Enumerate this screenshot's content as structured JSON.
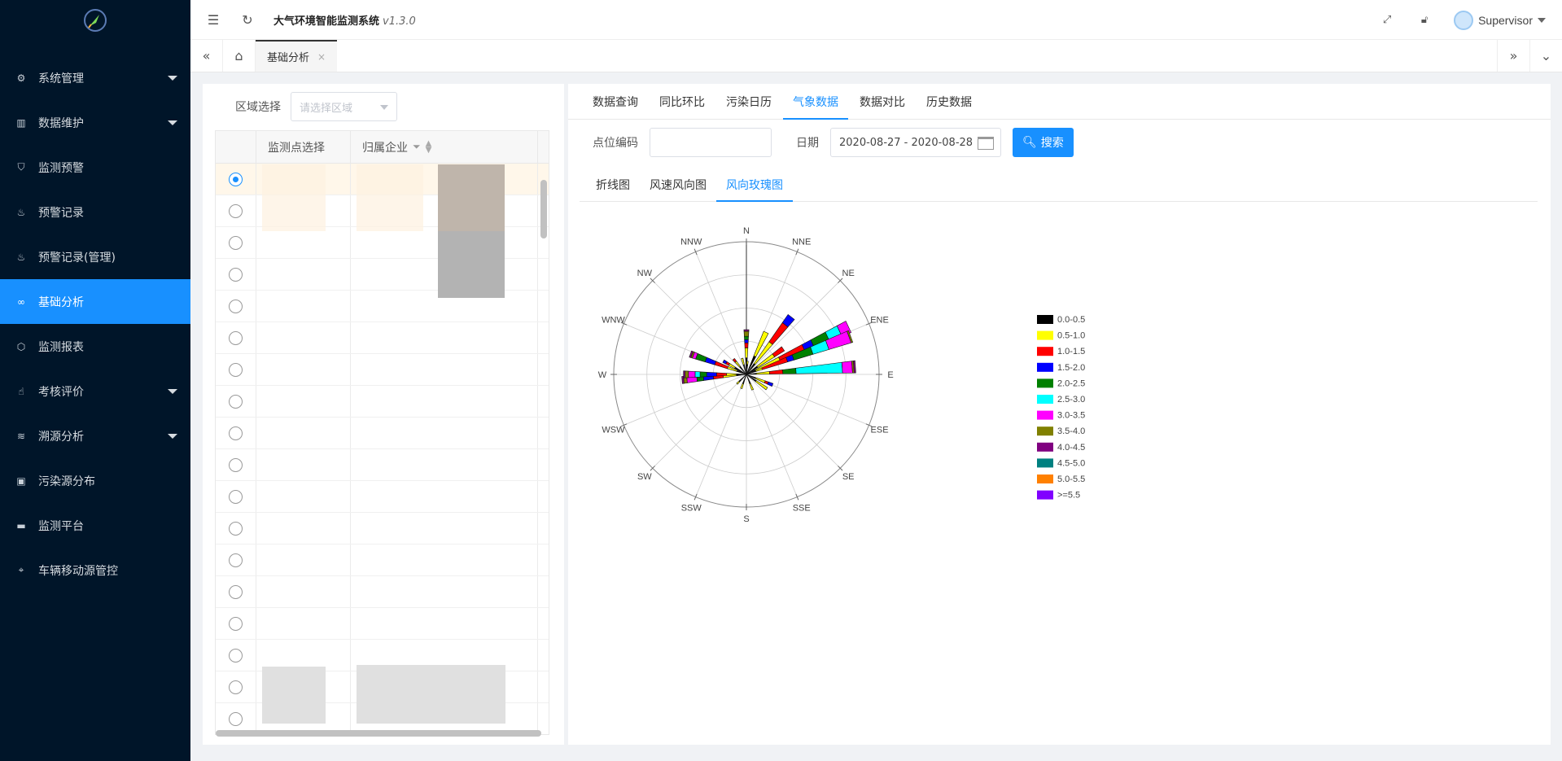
{
  "app": {
    "title": "大气环境智能监测系统",
    "version": "v1.3.0"
  },
  "user": {
    "name": "Supervisor"
  },
  "sidebar": {
    "items": [
      {
        "label": "系统管理",
        "icon": "gear-icon",
        "expandable": true
      },
      {
        "label": "数据维护",
        "icon": "book-icon",
        "expandable": true
      },
      {
        "label": "监测预警",
        "icon": "shield-icon",
        "expandable": false
      },
      {
        "label": "预警记录",
        "icon": "fire-icon",
        "expandable": false
      },
      {
        "label": "预警记录(管理)",
        "icon": "fire-icon",
        "expandable": false
      },
      {
        "label": "基础分析",
        "icon": "infinity-icon",
        "expandable": false,
        "active": true
      },
      {
        "label": "监测报表",
        "icon": "cube-icon",
        "expandable": false
      },
      {
        "label": "考核评价",
        "icon": "thumb-icon",
        "expandable": true
      },
      {
        "label": "溯源分析",
        "icon": "layers-icon",
        "expandable": true
      },
      {
        "label": "污染源分布",
        "icon": "image-icon",
        "expandable": false
      },
      {
        "label": "监测平台",
        "icon": "monitor-icon",
        "expandable": false
      },
      {
        "label": "车辆移动源管控",
        "icon": "location-icon",
        "expandable": false
      }
    ]
  },
  "tabs": {
    "active_tab": "基础分析",
    "close": "×"
  },
  "left": {
    "region_label": "区域选择",
    "region_placeholder": "请选择区域",
    "columns": [
      "监测点选择",
      "归属企业"
    ]
  },
  "right": {
    "tabs": [
      "数据查询",
      "同比环比",
      "污染日历",
      "气象数据",
      "数据对比",
      "历史数据"
    ],
    "active_tab": "气象数据",
    "form": {
      "code_label": "点位编码",
      "code_value": "",
      "date_label": "日期",
      "date_value": "2020-08-27 - 2020-08-28",
      "search_label": "搜索"
    },
    "subtabs": [
      "折线图",
      "风速风向图",
      "风向玫瑰图"
    ],
    "active_subtab": "风向玫瑰图"
  },
  "chart_data": {
    "type": "windrose",
    "directions": [
      "N",
      "NNE",
      "NE",
      "ENE",
      "E",
      "ESE",
      "SE",
      "SSE",
      "S",
      "SSW",
      "SW",
      "WSW",
      "W",
      "WNW",
      "NW",
      "NNW"
    ],
    "speed_bins": [
      {
        "name": "0.0-0.5",
        "color": "#000000"
      },
      {
        "name": "0.5-1.0",
        "color": "#ffff00"
      },
      {
        "name": "1.0-1.5",
        "color": "#ff0000"
      },
      {
        "name": "1.5-2.0",
        "color": "#0000ff"
      },
      {
        "name": "2.0-2.5",
        "color": "#008000"
      },
      {
        "name": "2.5-3.0",
        "color": "#00ffff"
      },
      {
        "name": "3.0-3.5",
        "color": "#ff00ff"
      },
      {
        "name": "3.5-4.0",
        "color": "#808000"
      },
      {
        "name": "4.0-4.5",
        "color": "#800080"
      },
      {
        "name": "4.5-5.0",
        "color": "#008080"
      },
      {
        "name": "5.0-5.5",
        "color": "#ff8000"
      },
      {
        "name": ">=5.5",
        "color": "#8000ff"
      }
    ],
    "max_radius_value": 4,
    "rings": 4,
    "angle_offsets_deg": [
      0,
      8,
      17,
      8,
      5,
      12,
      8,
      17,
      -5,
      0,
      10,
      13,
      4,
      7,
      5,
      18,
      -2,
      3,
      0,
      12,
      -9,
      0,
      2
    ],
    "spokes": [
      {
        "angle": 0,
        "segments": [
          0.5,
          0.3,
          0.15,
          0.1,
          0.1,
          0,
          0,
          0.15,
          0.05,
          0,
          0,
          0
        ]
      },
      {
        "angle": 25,
        "segments": [
          0.6,
          0.8,
          0,
          0,
          0,
          0,
          0,
          0,
          0,
          0,
          0,
          0
        ]
      },
      {
        "angle": 38,
        "segments": [
          0.4,
          0.8,
          0.7,
          0.3,
          0,
          0,
          0,
          0,
          0,
          0,
          0,
          0
        ]
      },
      {
        "angle": 55,
        "segments": [
          0.4,
          0.6,
          0.35,
          0,
          0,
          0,
          0,
          0,
          0,
          0,
          0,
          0
        ]
      },
      {
        "angle": 65,
        "segments": [
          0.3,
          0.8,
          0.8,
          0.3,
          0.5,
          0.4,
          0.3,
          0,
          0,
          0,
          0,
          0
        ]
      },
      {
        "angle": 70,
        "segments": [
          0.3,
          0.2,
          0.8,
          0.2,
          0.6,
          0.5,
          0.7,
          0.05,
          0,
          0,
          0,
          0
        ]
      },
      {
        "angle": 86,
        "segments": [
          0.3,
          0.4,
          0.4,
          0,
          0.4,
          1.4,
          0.3,
          0.05,
          0.05,
          0,
          0,
          0
        ]
      },
      {
        "angle": 112,
        "segments": [
          0.3,
          0.3,
          0.1,
          0.15,
          0,
          0,
          0,
          0,
          0,
          0,
          0,
          0
        ]
      },
      {
        "angle": 125,
        "segments": [
          0.35,
          0.4,
          0,
          0,
          0,
          0,
          0,
          0,
          0,
          0,
          0,
          0
        ]
      },
      {
        "angle": 158,
        "segments": [
          0.3,
          0.2,
          0,
          0,
          0,
          0,
          0,
          0,
          0,
          0,
          0,
          0
        ]
      },
      {
        "angle": 200,
        "segments": [
          0.3,
          0.15,
          0,
          0,
          0,
          0,
          0,
          0,
          0,
          0,
          0,
          0
        ]
      },
      {
        "angle": 225,
        "segments": [
          0.3,
          0.1,
          0,
          0,
          0,
          0,
          0,
          0,
          0,
          0,
          0,
          0
        ]
      },
      {
        "angle": 265,
        "segments": [
          0.3,
          0.4,
          0.3,
          0.3,
          0.2,
          0,
          0.3,
          0.1,
          0.05,
          0,
          0,
          0
        ]
      },
      {
        "angle": 270,
        "segments": [
          0.3,
          0.3,
          0.3,
          0.3,
          0.2,
          0.15,
          0.2,
          0.1,
          0.05,
          0,
          0,
          0
        ]
      },
      {
        "angle": 290,
        "segments": [
          0.3,
          0.3,
          0.4,
          0.3,
          0.3,
          0,
          0.1,
          0.05,
          0.05,
          0,
          0,
          0
        ]
      },
      {
        "angle": 300,
        "segments": [
          0.4,
          0.2,
          0.1,
          0.1,
          0,
          0,
          0,
          0,
          0,
          0,
          0,
          0
        ]
      },
      {
        "angle": 320,
        "segments": [
          0.3,
          0.2,
          0.1,
          0,
          0,
          0,
          0,
          0,
          0,
          0,
          0,
          0
        ]
      },
      {
        "angle": 345,
        "segments": [
          0.3,
          0.2,
          0,
          0,
          0,
          0,
          0,
          0,
          0,
          0,
          0,
          0
        ]
      },
      {
        "angle": 5,
        "segments": [
          0.3,
          0.1,
          0,
          0,
          0,
          0,
          0,
          0,
          0,
          0,
          0,
          0
        ]
      }
    ]
  }
}
